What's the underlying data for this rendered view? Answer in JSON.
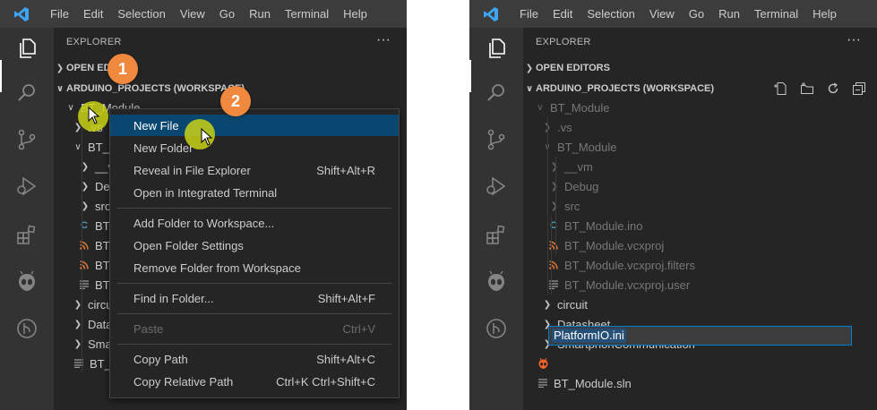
{
  "menubar": {
    "items": [
      "File",
      "Edit",
      "Selection",
      "View",
      "Go",
      "Run",
      "Terminal",
      "Help"
    ]
  },
  "activitybar": {
    "icons": [
      "files-icon",
      "search-icon",
      "source-control-icon",
      "run-debug-icon",
      "extensions-icon",
      "platformio-alien-icon",
      "git-graph-icon"
    ]
  },
  "explorer": {
    "title": "EXPLORER",
    "more": "···",
    "open_editors": "OPEN EDITORS",
    "open_editors_truncated": "OPEN EDI",
    "workspace": "ARDUINO_PROJECTS (WORKSPACE)"
  },
  "left_tree": [
    {
      "label": "BT_Module",
      "twisty": "v"
    },
    {
      "label": ".vs",
      "twisty": ">"
    },
    {
      "label": "BT_M",
      "twisty": "v"
    },
    {
      "label": "__v",
      "twisty": ">"
    },
    {
      "label": "Deb",
      "twisty": ">"
    },
    {
      "label": "src",
      "twisty": ">"
    },
    {
      "label": "BT_",
      "icon": "C"
    },
    {
      "label": "BT_",
      "icon": "rss"
    },
    {
      "label": "BT_",
      "icon": "rss"
    },
    {
      "label": "BT_",
      "icon": "lines"
    },
    {
      "label": "circui",
      "twisty": ">"
    },
    {
      "label": "Datas",
      "twisty": ">"
    },
    {
      "label": "Smar",
      "twisty": ">"
    },
    {
      "label": "BT_M",
      "icon": "lines"
    }
  ],
  "right_tree": [
    {
      "label": "BT_Module",
      "twisty": "v"
    },
    {
      "label": ".vs",
      "twisty": ">"
    },
    {
      "label": "BT_Module",
      "twisty": "v"
    },
    {
      "label": "__vm",
      "twisty": ">"
    },
    {
      "label": "Debug",
      "twisty": ">"
    },
    {
      "label": "src",
      "twisty": ">"
    },
    {
      "label": "BT_Module.ino",
      "icon": "C"
    },
    {
      "label": "BT_Module.vcxproj",
      "icon": "rss"
    },
    {
      "label": "BT_Module.vcxproj.filters",
      "icon": "rss"
    },
    {
      "label": "BT_Module.vcxproj.user",
      "icon": "lines"
    },
    {
      "label": "circuit",
      "twisty": ">"
    },
    {
      "label": "Datasheet",
      "twisty": ">"
    },
    {
      "label": "SmartphonCommunication",
      "twisty": ">"
    },
    {
      "label": "PlatformIO.ini",
      "icon": "alien",
      "editing": true
    },
    {
      "label": "BT_Module.sln",
      "icon": "lines"
    }
  ],
  "context_menu": {
    "groups": [
      [
        {
          "label": "New File",
          "shortcut": "",
          "active": true
        },
        {
          "label": "New Folder",
          "shortcut": ""
        },
        {
          "label": "Reveal in File Explorer",
          "shortcut": "Shift+Alt+R"
        },
        {
          "label": "Open in Integrated Terminal",
          "shortcut": ""
        }
      ],
      [
        {
          "label": "Add Folder to Workspace...",
          "shortcut": ""
        },
        {
          "label": "Open Folder Settings",
          "shortcut": ""
        },
        {
          "label": "Remove Folder from Workspace",
          "shortcut": ""
        }
      ],
      [
        {
          "label": "Find in Folder...",
          "shortcut": "Shift+Alt+F"
        }
      ],
      [
        {
          "label": "Paste",
          "shortcut": "Ctrl+V",
          "disabled": true
        }
      ],
      [
        {
          "label": "Copy Path",
          "shortcut": "Shift+Alt+C"
        },
        {
          "label": "Copy Relative Path",
          "shortcut": "Ctrl+K Ctrl+Shift+C"
        }
      ]
    ]
  },
  "steps": [
    "1",
    "2"
  ],
  "colors": {
    "accent_selection": "#094771",
    "badge": "#f0883e",
    "click_highlight": "#c8d214",
    "rename_border": "#007fd4"
  }
}
